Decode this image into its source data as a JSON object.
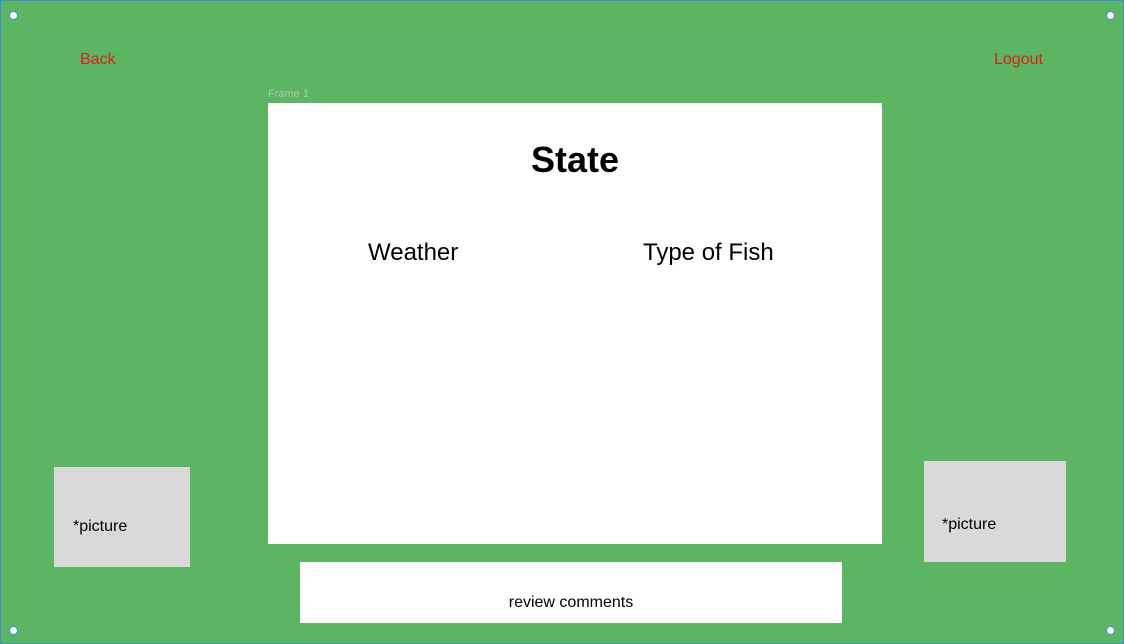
{
  "nav": {
    "back_label": "Back",
    "logout_label": "Logout"
  },
  "frame": {
    "label": "Frame 1",
    "title": "State",
    "weather_heading": "Weather",
    "fish_heading": "Type of Fish"
  },
  "pictures": {
    "left_label": "*picture",
    "right_label": "*picture"
  },
  "review": {
    "label": "review comments"
  },
  "colors": {
    "background": "#5cb562",
    "link": "#d4231a",
    "placeholder": "#d9d9d9",
    "selection": "#3a8fd6"
  }
}
